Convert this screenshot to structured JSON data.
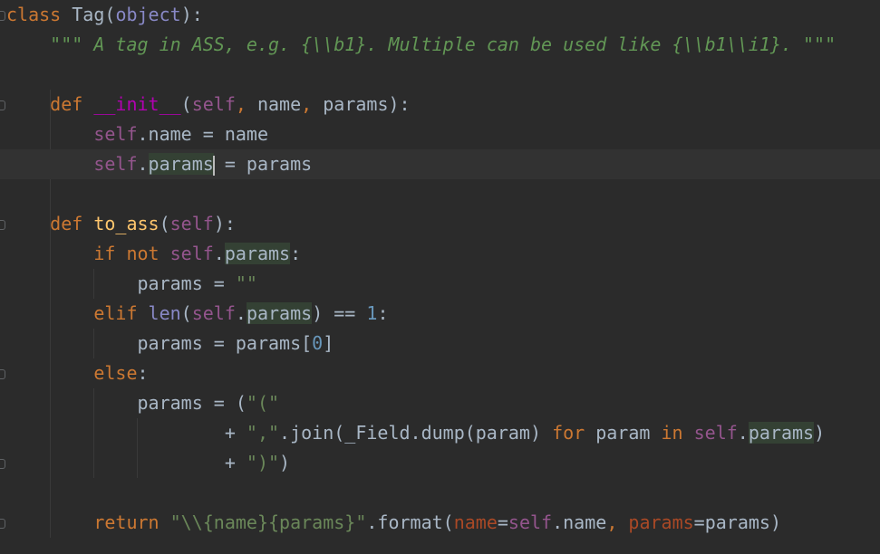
{
  "editor": {
    "lines": [
      [
        [
          "kw",
          "class"
        ],
        [
          "plain",
          " Tag("
        ],
        [
          "builtin",
          "object"
        ],
        [
          "plain",
          "):"
        ]
      ],
      [
        [
          "plain",
          "    "
        ],
        [
          "doc",
          "\"\"\" A tag in ASS, e.g. {\\\\b1}. Multiple can be used like {\\\\b1\\\\i1}. \"\"\""
        ]
      ],
      [],
      [
        [
          "plain",
          "    "
        ],
        [
          "kw",
          "def"
        ],
        [
          "plain",
          " "
        ],
        [
          "magic",
          "__init__"
        ],
        [
          "plain",
          "("
        ],
        [
          "self",
          "self"
        ],
        [
          "kw",
          ","
        ],
        [
          "plain",
          " name"
        ],
        [
          "kw",
          ","
        ],
        [
          "plain",
          " params):"
        ]
      ],
      [
        [
          "plain",
          "        "
        ],
        [
          "self",
          "self"
        ],
        [
          "plain",
          ".name = name"
        ]
      ],
      [
        [
          "plain",
          "        "
        ],
        [
          "self",
          "self"
        ],
        [
          "plain",
          "."
        ],
        [
          "usage",
          "params"
        ],
        [
          "caret",
          ""
        ],
        [
          "plain",
          " = params"
        ]
      ],
      [],
      [
        [
          "plain",
          "    "
        ],
        [
          "kw",
          "def"
        ],
        [
          "plain",
          " "
        ],
        [
          "fn",
          "to_ass"
        ],
        [
          "plain",
          "("
        ],
        [
          "self",
          "self"
        ],
        [
          "plain",
          "):"
        ]
      ],
      [
        [
          "plain",
          "        "
        ],
        [
          "kw",
          "if not"
        ],
        [
          "plain",
          " "
        ],
        [
          "self",
          "self"
        ],
        [
          "plain",
          "."
        ],
        [
          "usage",
          "params"
        ],
        [
          "plain",
          ":"
        ]
      ],
      [
        [
          "plain",
          "            params = "
        ],
        [
          "str",
          "\"\""
        ]
      ],
      [
        [
          "plain",
          "        "
        ],
        [
          "kw",
          "elif"
        ],
        [
          "plain",
          " "
        ],
        [
          "builtin",
          "len"
        ],
        [
          "plain",
          "("
        ],
        [
          "self",
          "self"
        ],
        [
          "plain",
          "."
        ],
        [
          "usage",
          "params"
        ],
        [
          "plain",
          ") == "
        ],
        [
          "num",
          "1"
        ],
        [
          "plain",
          ":"
        ]
      ],
      [
        [
          "plain",
          "            params = params["
        ],
        [
          "num",
          "0"
        ],
        [
          "plain",
          "]"
        ]
      ],
      [
        [
          "plain",
          "        "
        ],
        [
          "kw",
          "else"
        ],
        [
          "plain",
          ":"
        ]
      ],
      [
        [
          "plain",
          "            params = ("
        ],
        [
          "str",
          "\"(\""
        ]
      ],
      [
        [
          "plain",
          "                    + "
        ],
        [
          "str",
          "\",\""
        ],
        [
          "plain",
          ".join(_Field.dump(param) "
        ],
        [
          "kw",
          "for"
        ],
        [
          "plain",
          " param "
        ],
        [
          "kw",
          "in"
        ],
        [
          "plain",
          " "
        ],
        [
          "self",
          "self"
        ],
        [
          "plain",
          "."
        ],
        [
          "usage",
          "params"
        ],
        [
          "plain",
          ")"
        ]
      ],
      [
        [
          "plain",
          "                    + "
        ],
        [
          "str",
          "\")\""
        ],
        [
          "plain",
          ")"
        ]
      ],
      [],
      [
        [
          "plain",
          "        "
        ],
        [
          "kw",
          "return"
        ],
        [
          "plain",
          " "
        ],
        [
          "str",
          "\"\\\\{name}{params}\""
        ],
        [
          "plain",
          ".format("
        ],
        [
          "named",
          "name"
        ],
        [
          "plain",
          "="
        ],
        [
          "self",
          "self"
        ],
        [
          "plain",
          ".name"
        ],
        [
          "kw",
          ","
        ],
        [
          "plain",
          " "
        ],
        [
          "named",
          "params"
        ],
        [
          "plain",
          "=params)"
        ]
      ]
    ]
  }
}
